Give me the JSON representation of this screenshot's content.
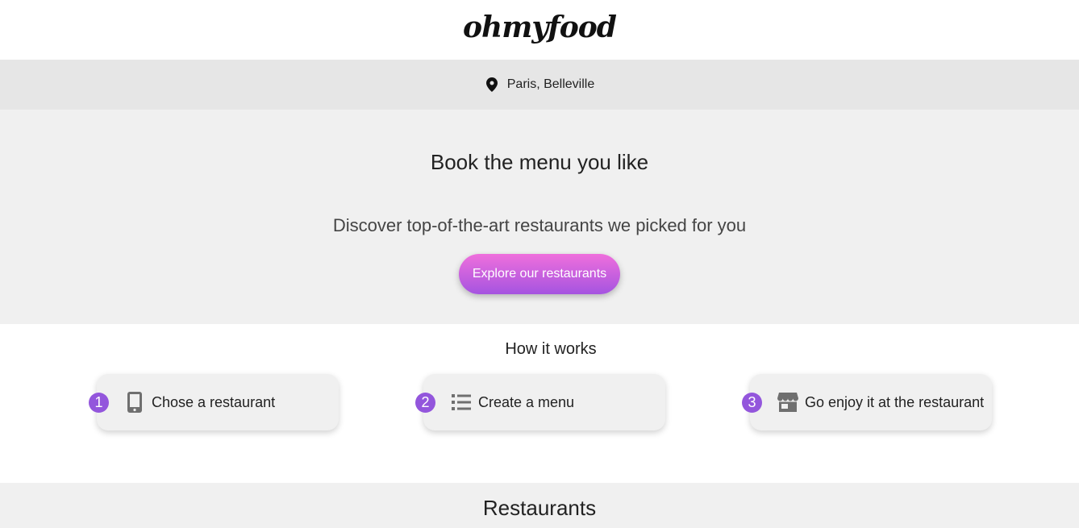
{
  "header": {
    "logo": "ohmyfood"
  },
  "location": {
    "icon": "map-pin-icon",
    "text": "Paris, Belleville"
  },
  "hero": {
    "title": "Book the menu you like",
    "subtitle": "Discover top-of-the-art restaurants we picked for you",
    "button_label": "Explore our restaurants"
  },
  "how_it_works": {
    "title": "How it works",
    "steps": [
      {
        "number": "1",
        "icon": "mobile-phone-icon",
        "label": "Chose a restaurant"
      },
      {
        "number": "2",
        "icon": "list-icon",
        "label": "Create a menu"
      },
      {
        "number": "3",
        "icon": "store-icon",
        "label": "Go enjoy it at the restaurant"
      }
    ]
  },
  "restaurants": {
    "title": "Restaurants"
  },
  "colors": {
    "accent": "#9356dc",
    "gradient_start": "#ef6fdc",
    "gradient_end": "#a554e0"
  }
}
